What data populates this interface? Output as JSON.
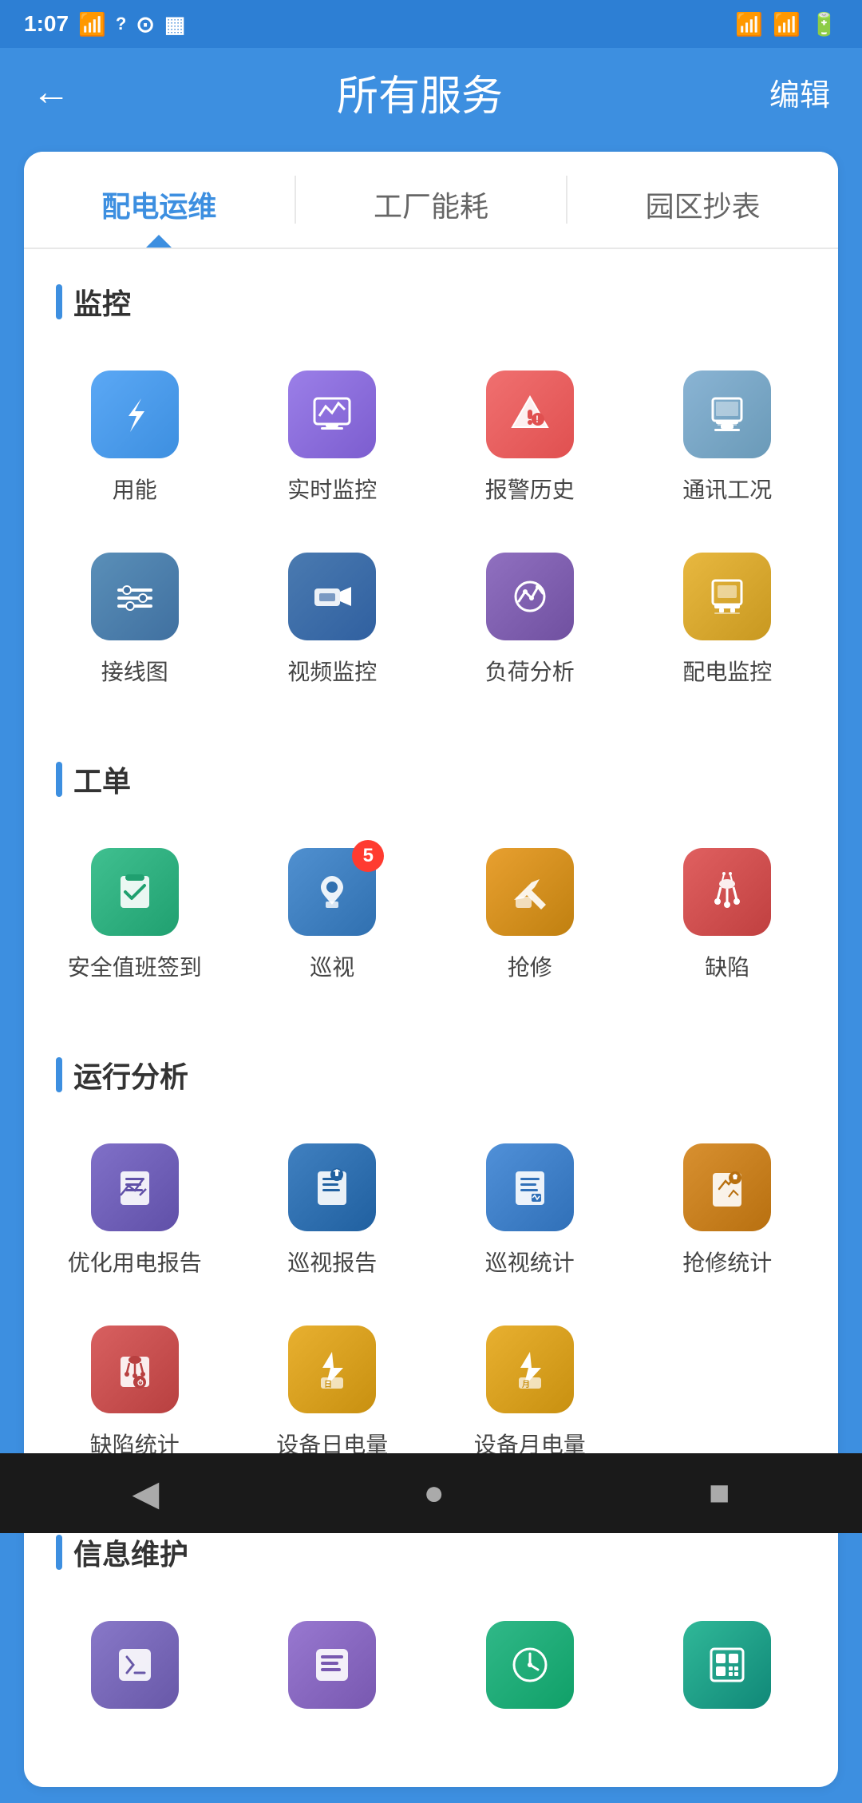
{
  "statusBar": {
    "time": "1:07",
    "icons": [
      "wifi",
      "question",
      "user-circle",
      "sim"
    ]
  },
  "header": {
    "back": "←",
    "title": "所有服务",
    "edit": "编辑"
  },
  "tabs": [
    {
      "id": "tab1",
      "label": "配电运维",
      "active": true
    },
    {
      "id": "tab2",
      "label": "工厂能耗",
      "active": false
    },
    {
      "id": "tab3",
      "label": "园区抄表",
      "active": false
    }
  ],
  "sections": [
    {
      "id": "monitor",
      "title": "监控",
      "items": [
        {
          "id": "energy",
          "label": "用能",
          "icon": "⚡",
          "bg": "bg-blue-light",
          "badge": null
        },
        {
          "id": "realtime",
          "label": "实时监控",
          "icon": "📈",
          "bg": "bg-purple",
          "badge": null
        },
        {
          "id": "alarm",
          "label": "报警历史",
          "icon": "⚠",
          "bg": "bg-red-orange",
          "badge": null
        },
        {
          "id": "comm",
          "label": "通讯工况",
          "icon": "🖥",
          "bg": "bg-gray-blue",
          "badge": null
        },
        {
          "id": "wiring",
          "label": "接线图",
          "icon": "⚙",
          "bg": "bg-blue2",
          "badge": null
        },
        {
          "id": "video",
          "label": "视频监控",
          "icon": "📹",
          "bg": "bg-dark-blue",
          "badge": null
        },
        {
          "id": "load",
          "label": "负荷分析",
          "icon": "📊",
          "bg": "bg-purple2",
          "badge": null
        },
        {
          "id": "power",
          "label": "配电监控",
          "icon": "🖨",
          "bg": "bg-gold",
          "badge": null
        }
      ]
    },
    {
      "id": "workorder",
      "title": "工单",
      "items": [
        {
          "id": "checkin",
          "label": "安全值班签到",
          "icon": "✅",
          "bg": "bg-teal",
          "badge": null
        },
        {
          "id": "patrol",
          "label": "巡视",
          "icon": "👷",
          "bg": "bg-blue3",
          "badge": "5"
        },
        {
          "id": "repair",
          "label": "抢修",
          "icon": "🔧",
          "bg": "bg-gold2",
          "badge": null
        },
        {
          "id": "defect",
          "label": "缺陷",
          "icon": "🐛",
          "bg": "bg-red2",
          "badge": null
        }
      ]
    },
    {
      "id": "analysis",
      "title": "运行分析",
      "items": [
        {
          "id": "elec-report",
          "label": "优化用电报告",
          "icon": "📋",
          "bg": "bg-purple3",
          "badge": null
        },
        {
          "id": "patrol-report",
          "label": "巡视报告",
          "icon": "📋",
          "bg": "bg-blue4",
          "badge": null
        },
        {
          "id": "patrol-stat",
          "label": "巡视统计",
          "icon": "📊",
          "bg": "bg-blue5",
          "badge": null
        },
        {
          "id": "repair-stat",
          "label": "抢修统计",
          "icon": "🔧",
          "bg": "bg-gold3",
          "badge": null
        },
        {
          "id": "defect-stat",
          "label": "缺陷统计",
          "icon": "🐛",
          "bg": "bg-red3",
          "badge": null
        },
        {
          "id": "day-elec",
          "label": "设备日电量",
          "icon": "⚡",
          "bg": "bg-yellow2",
          "badge": null
        },
        {
          "id": "month-elec",
          "label": "设备月电量",
          "icon": "⚡",
          "bg": "bg-yellow3",
          "badge": null
        }
      ]
    },
    {
      "id": "info",
      "title": "信息维护",
      "items": [
        {
          "id": "info1",
          "label": "",
          "icon": "⚙",
          "bg": "bg-purple4",
          "badge": null
        },
        {
          "id": "info2",
          "label": "",
          "icon": "📋",
          "bg": "bg-purple5",
          "badge": null
        },
        {
          "id": "info3",
          "label": "",
          "icon": "🕐",
          "bg": "bg-teal2",
          "badge": null
        },
        {
          "id": "info4",
          "label": "",
          "icon": "📱",
          "bg": "bg-teal3",
          "badge": null
        }
      ]
    }
  ],
  "navBar": {
    "back": "◀",
    "home": "●",
    "square": "■"
  }
}
